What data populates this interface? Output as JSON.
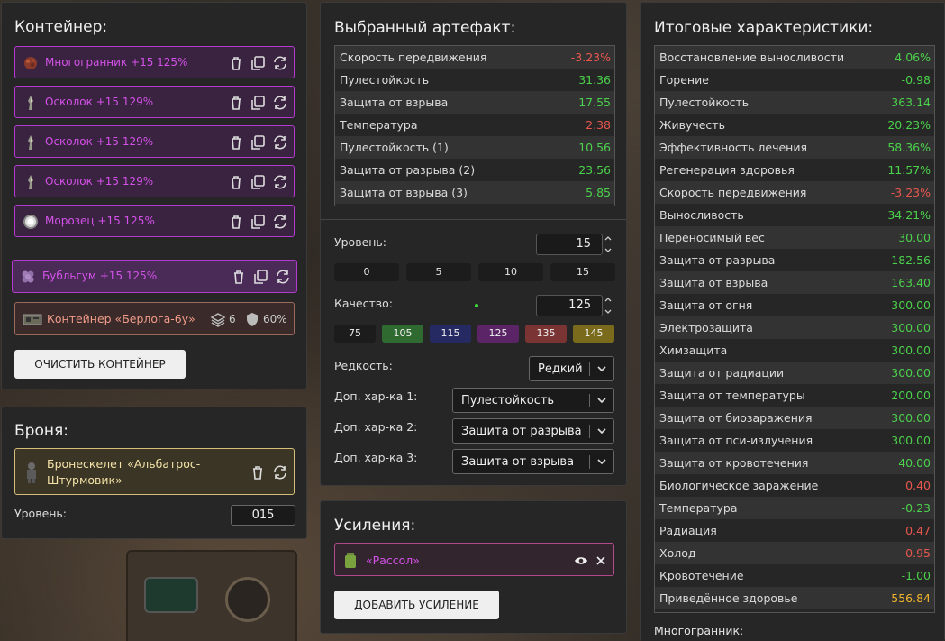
{
  "container_panel": {
    "title": "Контейнер:",
    "items": [
      {
        "label": "Многогранник +15 125%",
        "icon": "polyhedron-icon"
      },
      {
        "label": "Осколок +15 129%",
        "icon": "shard-icon"
      },
      {
        "label": "Осколок +15 129%",
        "icon": "shard-icon"
      },
      {
        "label": "Осколок +15 129%",
        "icon": "shard-icon"
      },
      {
        "label": "Морозец +15 125%",
        "icon": "frost-icon"
      },
      {
        "label": "Бубльгум +15 125%",
        "icon": "bubblegum-icon"
      }
    ],
    "container_name": "Контейнер «Берлога-6у»",
    "slots": "6",
    "protection": "60%",
    "clear_button": "ОЧИСТИТЬ КОНТЕЙНЕР"
  },
  "armor_panel": {
    "title": "Броня:",
    "armor_name": "Бронескелет «Альбатрос-Штурмовик»",
    "level_label": "Уровень:",
    "level_value": "015"
  },
  "artifact_panel": {
    "title": "Выбранный артефакт:",
    "stats": [
      {
        "name": "Скорость передвижения",
        "value": "-3.23%",
        "tone": "neg"
      },
      {
        "name": "Пулестойкость",
        "value": "31.36",
        "tone": "pos"
      },
      {
        "name": "Защита от взрыва",
        "value": "17.55",
        "tone": "pos"
      },
      {
        "name": "Температура",
        "value": "2.38",
        "tone": "neg"
      },
      {
        "name": "Пулестойкость (1)",
        "value": "10.56",
        "tone": "pos"
      },
      {
        "name": "Защита от разрыва (2)",
        "value": "23.56",
        "tone": "pos"
      },
      {
        "name": "Защита от взрыва (3)",
        "value": "5.85",
        "tone": "pos"
      }
    ],
    "level_label": "Уровень:",
    "level_value": "15",
    "level_presets": [
      "0",
      "5",
      "10",
      "15"
    ],
    "quality_label": "Качество:",
    "quality_value": "125",
    "quality_presets": [
      {
        "label": "75",
        "color": "#1c1c1c"
      },
      {
        "label": "105",
        "color": "#2f6b30"
      },
      {
        "label": "115",
        "color": "#252a63"
      },
      {
        "label": "125",
        "color": "#5a2466"
      },
      {
        "label": "135",
        "color": "#7a3434"
      },
      {
        "label": "145",
        "color": "#7a6a1c"
      }
    ],
    "rarity_label": "Редкость:",
    "rarity_value": "Редкий",
    "extra1_label": "Доп. хар-ка 1:",
    "extra1_value": "Пулестойкость",
    "extra2_label": "Доп. хар-ка 2:",
    "extra2_value": "Защита от разрыва",
    "extra3_label": "Доп. хар-ка 3:",
    "extra3_value": "Защита от взрыва"
  },
  "boosts_panel": {
    "title": "Усиления:",
    "boost_name": "«Рассол»",
    "add_button": "ДОБАВИТЬ УСИЛЕНИЕ"
  },
  "totals_panel": {
    "title": "Итоговые характеристики:",
    "stats": [
      {
        "name": "Восстановление выносливости",
        "value": "4.06%",
        "tone": "pos"
      },
      {
        "name": "Горение",
        "value": "-0.98",
        "tone": "pos"
      },
      {
        "name": "Пулестойкость",
        "value": "363.14",
        "tone": "pos"
      },
      {
        "name": "Живучесть",
        "value": "20.23%",
        "tone": "pos"
      },
      {
        "name": "Эффективность лечения",
        "value": "58.36%",
        "tone": "pos"
      },
      {
        "name": "Регенерация здоровья",
        "value": "11.57%",
        "tone": "pos"
      },
      {
        "name": "Скорость передвижения",
        "value": "-3.23%",
        "tone": "neg"
      },
      {
        "name": "Выносливость",
        "value": "34.21%",
        "tone": "pos"
      },
      {
        "name": "Переносимый вес",
        "value": "30.00",
        "tone": "pos"
      },
      {
        "name": "Защита от разрыва",
        "value": "182.56",
        "tone": "pos"
      },
      {
        "name": "Защита от взрыва",
        "value": "163.40",
        "tone": "pos"
      },
      {
        "name": "Защита от огня",
        "value": "300.00",
        "tone": "pos"
      },
      {
        "name": "Электрозащита",
        "value": "300.00",
        "tone": "pos"
      },
      {
        "name": "Химзащита",
        "value": "300.00",
        "tone": "pos"
      },
      {
        "name": "Защита от радиации",
        "value": "300.00",
        "tone": "pos"
      },
      {
        "name": "Защита от температуры",
        "value": "200.00",
        "tone": "pos"
      },
      {
        "name": "Защита от биозаражения",
        "value": "300.00",
        "tone": "pos"
      },
      {
        "name": "Защита от пси-излучения",
        "value": "300.00",
        "tone": "pos"
      },
      {
        "name": "Защита от кровотечения",
        "value": "40.00",
        "tone": "pos"
      },
      {
        "name": "Биологическое заражение",
        "value": "0.40",
        "tone": "neg"
      },
      {
        "name": "Температура",
        "value": "-0.23",
        "tone": "pos"
      },
      {
        "name": "Радиация",
        "value": "0.47",
        "tone": "neg"
      },
      {
        "name": "Холод",
        "value": "0.95",
        "tone": "neg"
      },
      {
        "name": "Кровотечение",
        "value": "-1.00",
        "tone": "pos"
      },
      {
        "name": "Приведённое здоровье",
        "value": "556.84",
        "tone": "gold"
      }
    ],
    "footer_label": "Многогранник:"
  }
}
